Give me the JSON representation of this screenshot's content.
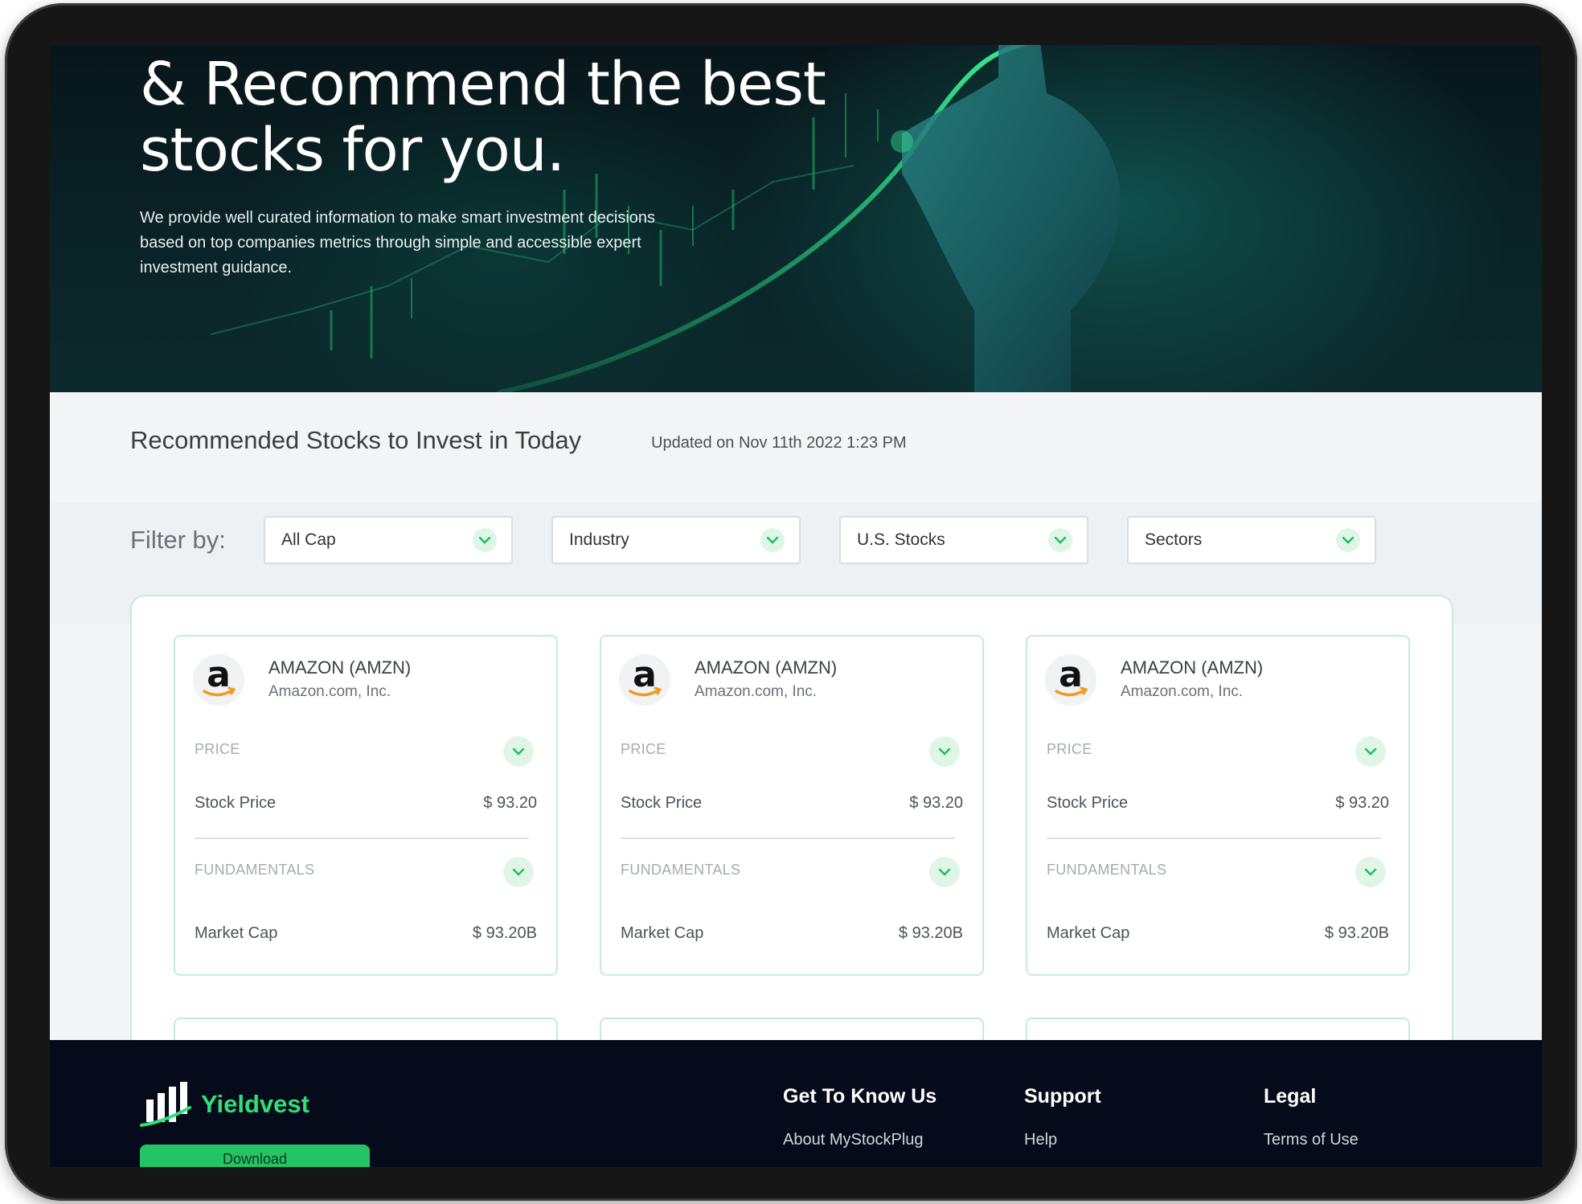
{
  "hero": {
    "title_line1": "& Recommend the best",
    "title_line2": "stocks for you.",
    "description": "We provide well curated information to make smart investment decisions based on top companies metrics through simple and accessible expert investment guidance."
  },
  "section": {
    "title": "Recommended Stocks to Invest in Today",
    "updated": "Updated on Nov 11th 2022  1:23 PM"
  },
  "filters": {
    "label": "Filter by:",
    "items": [
      {
        "value": "All Cap"
      },
      {
        "value": "Industry"
      },
      {
        "value": "U.S. Stocks"
      },
      {
        "value": "Sectors"
      }
    ]
  },
  "cards": [
    {
      "logo_letter": "a",
      "ticker": "AMAZON (AMZN)",
      "company": "Amazon.com, Inc.",
      "price_label": "PRICE",
      "stock_price_label": "Stock Price",
      "stock_price": "$ 93.20",
      "fundamentals_label": "FUNDAMENTALS",
      "market_cap_label": "Market Cap",
      "market_cap": "$ 93.20B"
    },
    {
      "logo_letter": "a",
      "ticker": "AMAZON (AMZN)",
      "company": "Amazon.com, Inc.",
      "price_label": "PRICE",
      "stock_price_label": "Stock Price",
      "stock_price": "$ 93.20",
      "fundamentals_label": "FUNDAMENTALS",
      "market_cap_label": "Market Cap",
      "market_cap": "$ 93.20B"
    },
    {
      "logo_letter": "a",
      "ticker": "AMAZON (AMZN)",
      "company": "Amazon.com, Inc.",
      "price_label": "PRICE",
      "stock_price_label": "Stock Price",
      "stock_price": "$ 93.20",
      "fundamentals_label": "FUNDAMENTALS",
      "market_cap_label": "Market Cap",
      "market_cap": "$ 93.20B"
    }
  ],
  "footer": {
    "brand": "Yieldvest",
    "download_label": "Download",
    "columns": [
      {
        "heading": "Get To Know Us",
        "link": "About MyStockPlug"
      },
      {
        "heading": "Support",
        "link": "Help"
      },
      {
        "heading": "Legal",
        "link": "Terms of Use"
      }
    ]
  },
  "colors": {
    "accent": "#2ee07a",
    "card_border": "#c5ecd8",
    "footer_bg": "#050b1a",
    "hero_bg": "#0a2226"
  }
}
